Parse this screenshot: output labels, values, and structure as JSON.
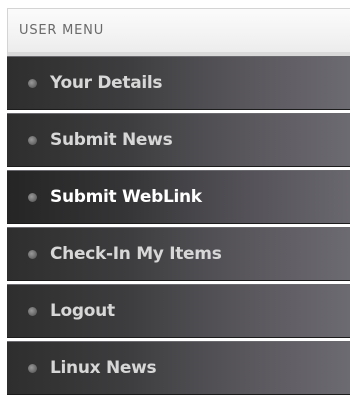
{
  "menu": {
    "header": "USER MENU",
    "items": [
      {
        "label": "Your Details",
        "bullet_icon": "round-bullet-icon",
        "active": false
      },
      {
        "label": "Submit News",
        "bullet_icon": "round-bullet-icon",
        "active": false
      },
      {
        "label": "Submit WebLink",
        "bullet_icon": "round-bullet-icon",
        "active": true
      },
      {
        "label": "Check-In My Items",
        "bullet_icon": "round-bullet-icon",
        "active": false
      },
      {
        "label": "Logout",
        "bullet_icon": "round-bullet-icon",
        "active": false
      },
      {
        "label": "Linux News",
        "bullet_icon": "round-bullet-icon",
        "active": false
      }
    ]
  },
  "colors": {
    "header_background": "#f3f3f3",
    "header_text": "#6a6a6a",
    "item_background_dark": "#2e2e2e",
    "item_background_light": "#6d6b72",
    "item_text": "#d7d7d7",
    "active_item_text": "#ffffff"
  }
}
